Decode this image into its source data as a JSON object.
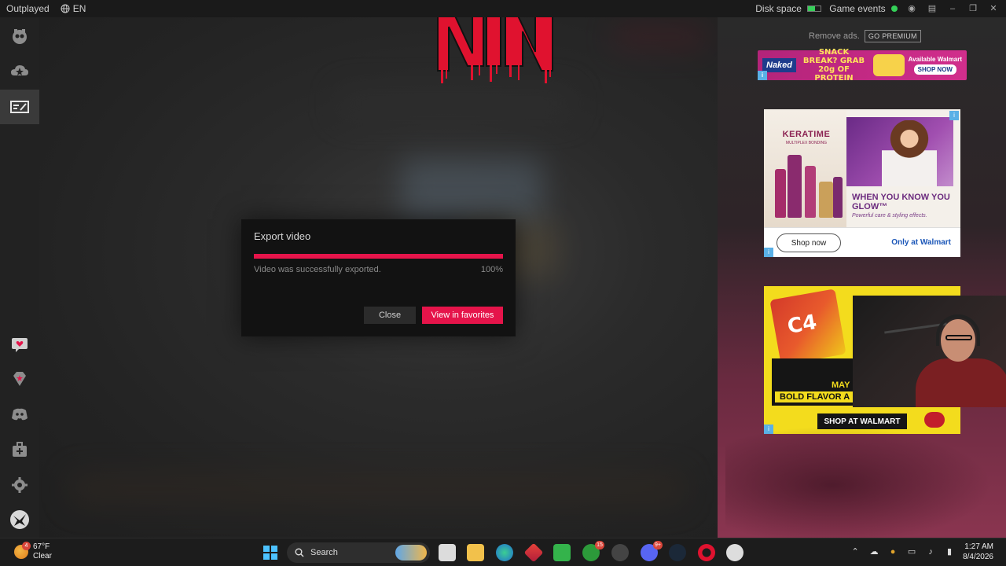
{
  "titlebar": {
    "app_name": "Outplayed",
    "language": "EN",
    "disk_space_label": "Disk space",
    "disk_space_fill": 0.55,
    "game_events_label": "Game events",
    "game_events_status_color": "#34d058"
  },
  "sidebar": {
    "items": [
      {
        "name": "home-icon",
        "active": false
      },
      {
        "name": "cloud-star-icon",
        "active": false
      },
      {
        "name": "editor-icon",
        "active": true
      },
      {
        "name": "feedback-heart-icon",
        "active": false
      },
      {
        "name": "premium-gem-icon",
        "active": false
      },
      {
        "name": "discord-icon",
        "active": false
      },
      {
        "name": "medkit-icon",
        "active": false
      },
      {
        "name": "settings-gear-icon",
        "active": false
      },
      {
        "name": "user-avatar",
        "active": false
      }
    ]
  },
  "overlay": {
    "logo_text": "NIN",
    "logo_color": "#e0122f"
  },
  "ads": {
    "remove_ads": "Remove ads.",
    "go_premium": "GO PREMIUM",
    "top_banner": {
      "brand": "Naked",
      "headline": "SNACK BREAK? GRAB 20g OF PROTEIN",
      "availability": "Available Walmart",
      "cta": "SHOP NOW"
    },
    "middle_banner": {
      "brand": "KERATIME",
      "brand_sub": "MULTIPLEX BONDING",
      "headline": "WHEN YOU KNOW YOU GLOW™",
      "subline": "Powerful care & styling effects.",
      "cta": "Shop now",
      "only_at": "Only at Walmart"
    },
    "bottom_banner": {
      "product": "C4",
      "may": "MAY",
      "headline": "BOLD FLAVOR A",
      "cta": "SHOP AT WALMART"
    }
  },
  "modal": {
    "title": "Export video",
    "status": "Video was successfully exported.",
    "percent_label": "100%",
    "progress": 1.0,
    "close_label": "Close",
    "view_label": "View in favorites",
    "accent": "#e5144a"
  },
  "taskbar": {
    "weather_temp": "67°F",
    "weather_desc": "Clear",
    "weather_badge": "4",
    "search_label": "Search",
    "xbox_badge": "15",
    "discord_badge": "9+",
    "time": "1:27 AM",
    "date": "8/4/2026"
  }
}
